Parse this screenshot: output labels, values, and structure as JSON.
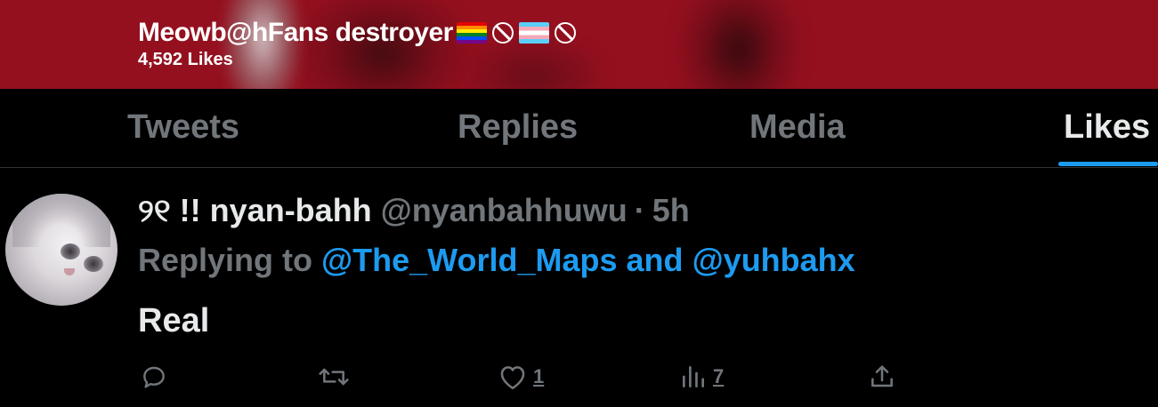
{
  "header": {
    "profile_name": "Meowb@hFans destroyer",
    "likes_count": "4,592 Likes",
    "bg_color": "#94101f"
  },
  "tabs": [
    {
      "label": "Tweets",
      "active": false
    },
    {
      "label": "Replies",
      "active": false
    },
    {
      "label": "Media",
      "active": false
    },
    {
      "label": "Likes",
      "active": true
    }
  ],
  "tweet": {
    "display_name": "୨୧ !! nyan-bahh",
    "handle": "@nyanbahhuwu",
    "separator": "·",
    "time": "5h",
    "replying_prefix": "Replying to",
    "mention1": "@The_World_Maps",
    "and": "and",
    "mention2": "@yuhbahx",
    "text": "Real",
    "actions": {
      "reply": {
        "icon": "reply-icon",
        "count": ""
      },
      "retweet": {
        "icon": "retweet-icon",
        "count": ""
      },
      "like": {
        "icon": "heart-icon",
        "count": "1"
      },
      "views": {
        "icon": "analytics-icon",
        "count": "7"
      },
      "share": {
        "icon": "share-icon",
        "count": ""
      }
    }
  },
  "colors": {
    "accent": "#1d9bf0",
    "muted": "#71767b",
    "text": "#e7e9ea",
    "background": "#000000"
  }
}
